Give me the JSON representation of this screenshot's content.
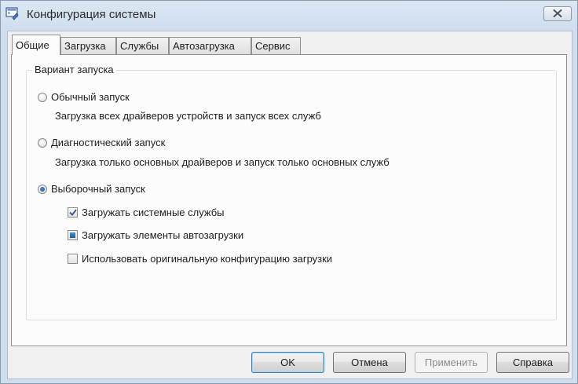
{
  "window": {
    "title": "Конфигурация системы",
    "app_icon": "msconfig-icon",
    "close_icon": "close-x-icon"
  },
  "tabs": [
    {
      "label": "Общие",
      "active": true
    },
    {
      "label": "Загрузка",
      "active": false
    },
    {
      "label": "Службы",
      "active": false
    },
    {
      "label": "Автозагрузка",
      "active": false
    },
    {
      "label": "Сервис",
      "active": false
    }
  ],
  "startup": {
    "group_label": "Вариант запуска",
    "normal": {
      "label": "Обычный запуск",
      "description": "Загрузка всех драйверов устройств и запуск всех служб",
      "selected": false
    },
    "diagnostic": {
      "label": "Диагностический запуск",
      "description": "Загрузка только основных драйверов и запуск только основных служб",
      "selected": false
    },
    "selective": {
      "label": "Выборочный запуск",
      "selected": true,
      "options": [
        {
          "label": "Загружать системные службы",
          "state": "checked"
        },
        {
          "label": "Загружать элементы автозагрузки",
          "state": "indeterminate"
        },
        {
          "label": "Использовать оригинальную конфигурацию загрузки",
          "state": "unchecked"
        }
      ]
    }
  },
  "buttons": {
    "ok": "OK",
    "cancel": "Отмена",
    "apply": "Применить",
    "help": "Справка"
  },
  "colors": {
    "title_bar": "#cfdeee",
    "panel": "#fcfcfc",
    "radio_dot": "#1c4f93",
    "check_mark": "#2f4f86"
  }
}
